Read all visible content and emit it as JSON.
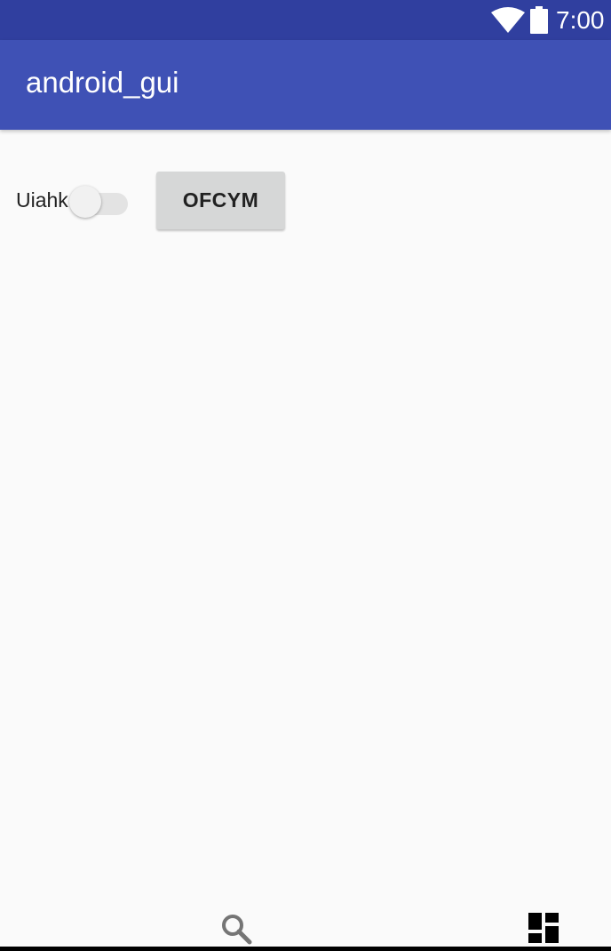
{
  "status_bar": {
    "time": "7:00",
    "icons": [
      "wifi-icon",
      "battery-icon"
    ],
    "background": "#303f9f"
  },
  "app_bar": {
    "title": "android_gui",
    "background": "#3f51b5"
  },
  "content": {
    "switch": {
      "label": "Uiahk",
      "checked": false
    },
    "button": {
      "label": "OFCYM"
    }
  },
  "bottom_bar": {
    "icons": [
      "search-icon",
      "dashboard-icon"
    ]
  },
  "colors": {
    "background": "#fafafa",
    "button": "#d6d7d7"
  }
}
